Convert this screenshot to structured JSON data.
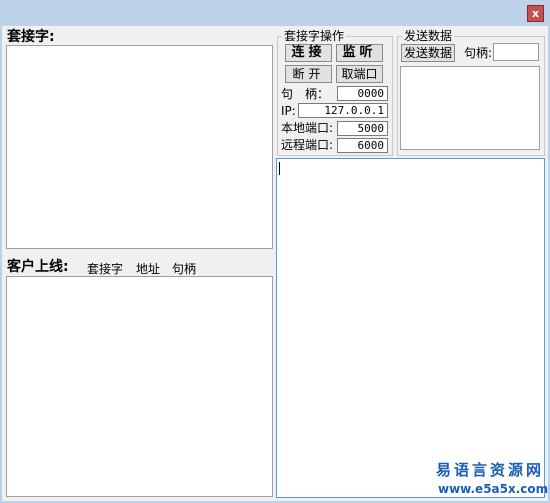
{
  "titlebar": {
    "close_label": "x"
  },
  "socket_section": {
    "title": "套接字:"
  },
  "clients_section": {
    "title": "客户上线:",
    "columns": [
      "套接字",
      "地址",
      "句柄"
    ]
  },
  "socket_ops": {
    "group_title": "套接字操作",
    "connect_label": "连接",
    "listen_label": "监听",
    "disconnect_label": "断开",
    "get_port_label": "取端口",
    "handle_label": "句　柄：",
    "handle_value": "0000",
    "ip_label": "IP:",
    "ip_value": "127.0.0.1",
    "local_port_label": "本地端口:",
    "local_port_value": "5000",
    "remote_port_label": "远程端口:",
    "remote_port_value": "6000"
  },
  "send_data": {
    "group_title": "发送数据",
    "send_button_label": "发送数据",
    "handle_label": "句柄:",
    "handle_value": ""
  },
  "watermark": {
    "line1": "易语言资源网",
    "line2": "www.e5a5x.com"
  }
}
